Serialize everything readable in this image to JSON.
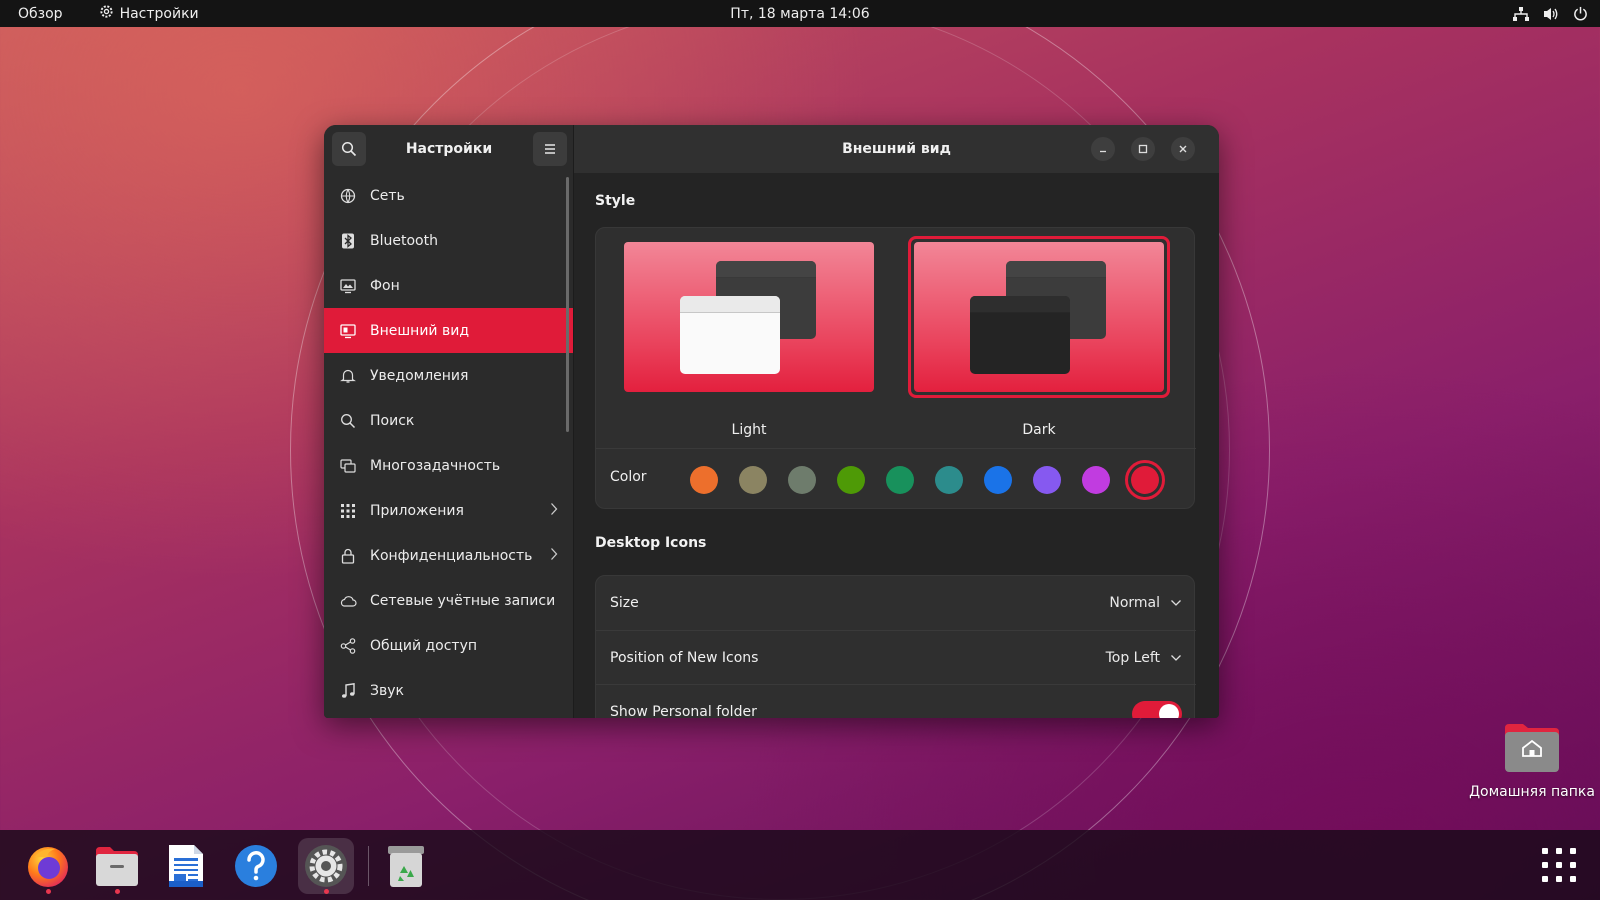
{
  "topbar": {
    "activities": "Обзор",
    "app_name": "Настройки",
    "clock": "Пт, 18 марта  14:06",
    "tray_icons": [
      "network-icon",
      "volume-icon",
      "power-icon"
    ]
  },
  "window": {
    "sidebar_title": "Настройки",
    "page_title": "Внешний вид",
    "accent_color": "#e01b39"
  },
  "sidebar": {
    "items": [
      {
        "label": "Сеть",
        "icon": "globe-icon"
      },
      {
        "label": "Bluetooth",
        "icon": "bluetooth-icon"
      },
      {
        "label": "Фон",
        "icon": "monitor-icon"
      },
      {
        "label": "Внешний вид",
        "icon": "appearance-icon",
        "active": true
      },
      {
        "label": "Уведомления",
        "icon": "bell-icon"
      },
      {
        "label": "Поиск",
        "icon": "search-icon"
      },
      {
        "label": "Многозадачность",
        "icon": "multitask-icon"
      },
      {
        "label": "Приложения",
        "icon": "apps-grid-icon",
        "has_submenu": true
      },
      {
        "label": "Конфиденциальность",
        "icon": "lock-icon",
        "has_submenu": true
      },
      {
        "label": "Сетевые учётные записи",
        "icon": "cloud-icon"
      },
      {
        "label": "Общий доступ",
        "icon": "share-icon"
      },
      {
        "label": "Звук",
        "icon": "music-note-icon"
      }
    ]
  },
  "style_section": {
    "title": "Style",
    "light_label": "Light",
    "dark_label": "Dark",
    "selected": "Dark",
    "color_label": "Color",
    "colors": [
      "#ed6f2c",
      "#8b8462",
      "#6e7c6c",
      "#4e9a06",
      "#18915c",
      "#2c8c8c",
      "#1a73e8",
      "#8659f0",
      "#c13ce0",
      "#e01b39"
    ],
    "selected_color": "#e01b39"
  },
  "desktop_icons_section": {
    "title": "Desktop Icons",
    "size_label": "Size",
    "size_value": "Normal",
    "position_label": "Position of New Icons",
    "position_value": "Top Left",
    "personal_folder_label": "Show Personal folder",
    "personal_folder_on": true
  },
  "dock": {
    "apps": [
      "firefox-icon",
      "files-icon",
      "writer-icon",
      "help-icon",
      "settings-icon",
      "trash-icon"
    ],
    "running": [
      "firefox-icon",
      "files-icon",
      "settings-icon"
    ]
  },
  "desktop": {
    "home_folder_label": "Домашняя папка"
  }
}
